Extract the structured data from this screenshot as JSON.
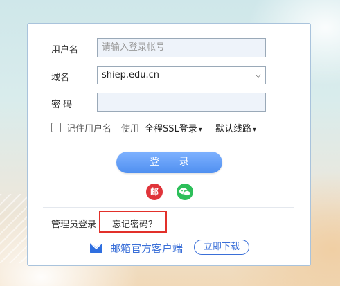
{
  "form": {
    "username_label": "用户名",
    "username_placeholder": "请输入登录帐号",
    "domain_label": "域名",
    "domain_value": "shiep.edu.cn",
    "password_label": "密 码",
    "password_value": ""
  },
  "options": {
    "remember_label": "记住用户名",
    "use_label": "使用",
    "ssl_option": "全程SSL登录",
    "line_option": "默认线路"
  },
  "actions": {
    "login_label": "登 录",
    "mail_icon_glyph": "邮",
    "admin_login": "管理员登录",
    "forgot_password": "忘记密码？"
  },
  "footer": {
    "client_label": "邮箱官方客户端",
    "download_label": "立即下载"
  },
  "colors": {
    "login_button": "#5b98f3",
    "highlight_border": "#e2302a",
    "link_blue": "#3a6fd8"
  }
}
